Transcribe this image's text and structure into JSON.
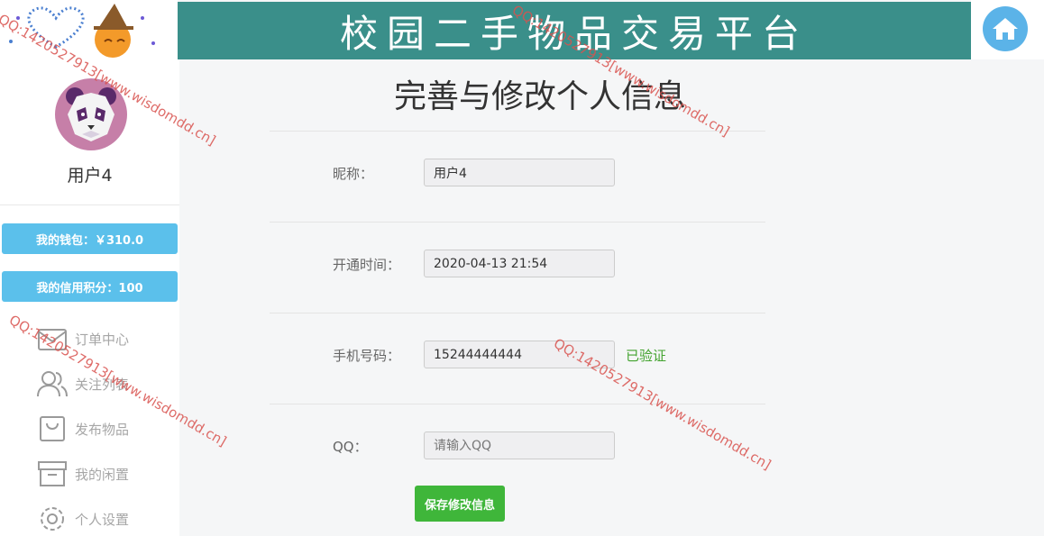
{
  "header": {
    "banner_title": "校园二手物品交易平台",
    "home_icon": "home-icon"
  },
  "sidebar": {
    "username": "用户4",
    "wallet_label": "我的钱包：￥310.0",
    "credit_label": "我的信用积分：100",
    "menu": [
      {
        "label": "订单中心",
        "icon": "mail-icon"
      },
      {
        "label": "关注列表",
        "icon": "users-icon"
      },
      {
        "label": "发布物品",
        "icon": "bag-icon"
      },
      {
        "label": "我的闲置",
        "icon": "archive-icon"
      },
      {
        "label": "个人设置",
        "icon": "gear-icon"
      }
    ]
  },
  "form": {
    "title": "完善与修改个人信息",
    "nickname_label": "昵称：",
    "nickname_value": "用户4",
    "open_time_label": "开通时间：",
    "open_time_value": "2020-04-13 21:54",
    "phone_label": "手机号码：",
    "phone_value": "15244444444",
    "phone_status": "已验证",
    "qq_label": "QQ：",
    "qq_placeholder": "请输入QQ",
    "save_label": "保存修改信息"
  },
  "watermark": "QQ:1420527913[www.wisdomdd.cn]",
  "colors": {
    "banner": "#3a8f8a",
    "accent_blue": "#5bc0eb",
    "save_green": "#3fb63a",
    "verified_green": "#43a32f",
    "watermark_red": "#d9534f"
  }
}
